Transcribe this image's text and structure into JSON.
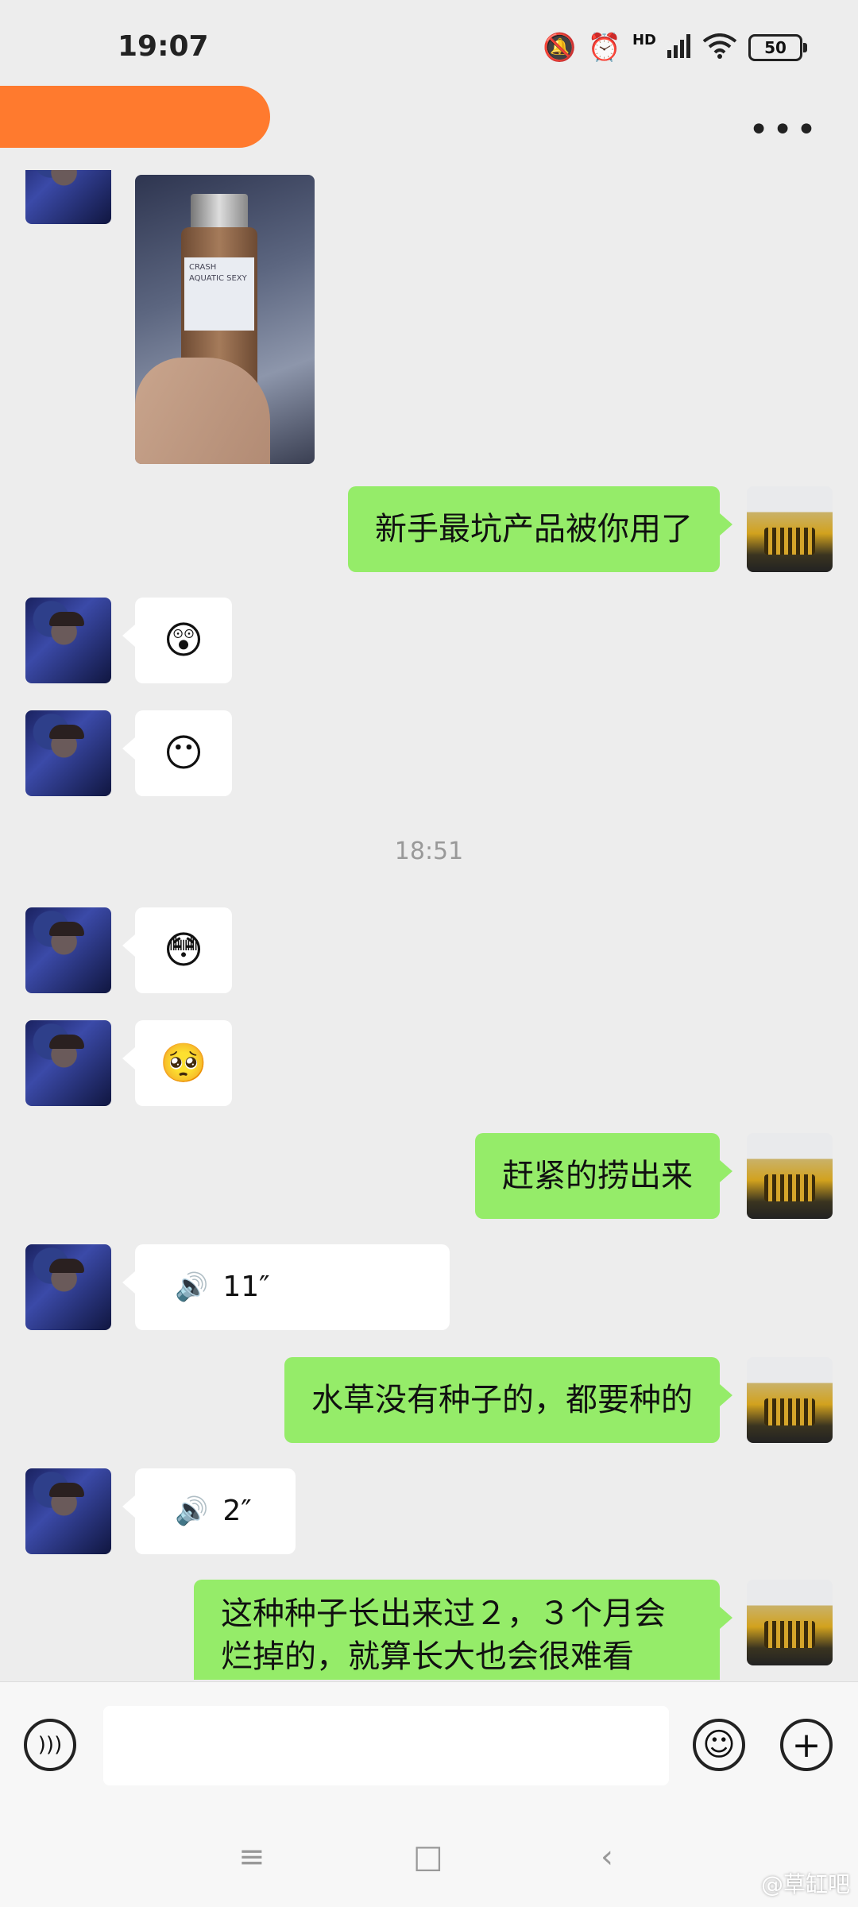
{
  "status_bar": {
    "time": "19:07",
    "network": "HD",
    "wifi_level": "6",
    "battery": "50"
  },
  "header": {
    "title": "",
    "menu_icon": "more-icon"
  },
  "messages": [
    {
      "side": "left",
      "type": "image",
      "image_label": "CRASH AQUATIC SEXY"
    },
    {
      "side": "right",
      "type": "text",
      "text": "新手最坑产品被你用了"
    },
    {
      "side": "left",
      "type": "emoji",
      "text": "😲"
    },
    {
      "side": "left",
      "type": "emoji",
      "text": "😶"
    },
    {
      "side": "center",
      "type": "timestamp",
      "text": "18:51"
    },
    {
      "side": "left",
      "type": "emoji",
      "text": "😳"
    },
    {
      "side": "left",
      "type": "emoji",
      "text": "🥺"
    },
    {
      "side": "right",
      "type": "text",
      "text": "赶紧的捞出来"
    },
    {
      "side": "left",
      "type": "voice",
      "text": "11″"
    },
    {
      "side": "right",
      "type": "text",
      "text": "水草没有种子的，都要种的"
    },
    {
      "side": "left",
      "type": "voice",
      "text": "2″"
    },
    {
      "side": "right",
      "type": "text",
      "text": "这种种子长出来过２，３个月会烂掉的，就算长大也会很难看"
    }
  ],
  "input_bar": {
    "voice_icon": "voice-toggle-icon",
    "emoji_icon": "emoji-icon",
    "plus_icon": "plus-icon",
    "text_value": ""
  },
  "nav_bar": {
    "menu": "≡",
    "home": "□",
    "back": "‹"
  },
  "watermark": "@草缸吧"
}
